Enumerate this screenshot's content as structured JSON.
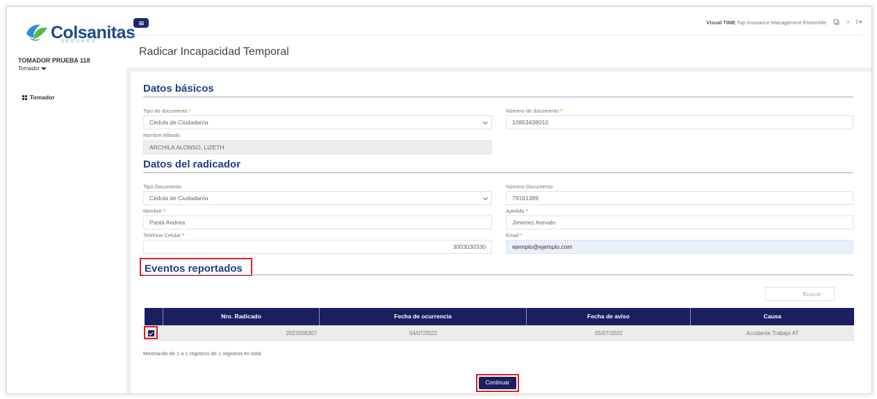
{
  "brand": {
    "name": "Colsanitas",
    "sub": "SEGUROS",
    "colors": {
      "primary": "#1e4a8c",
      "accent": "#4bb7a4",
      "nav_dark": "#1a1f60",
      "highlight": "#e02020"
    }
  },
  "user": {
    "name": "TOMADOR PRUEBA 118",
    "role": "Tomador"
  },
  "sidebar": {
    "items": [
      {
        "label": "Tomador",
        "icon": "grid-icon"
      }
    ]
  },
  "topbar": {
    "app_name": "Visual TIME",
    "app_desc": "Top Insurance Management Ensemble",
    "icons": [
      "notification-icon",
      "help-icon",
      "logout-icon"
    ],
    "help_label": "?"
  },
  "page": {
    "title": "Radicar Incapacidad Temporal"
  },
  "datos_basicos": {
    "title": "Datos básicos",
    "tipo_doc_label": "Tipo de documento",
    "tipo_doc_value": "Cédula de Ciudadanía",
    "num_doc_label": "Número de documento",
    "num_doc_value": "10853438010",
    "nombre_label": "Nombre Afiliado",
    "nombre_value": "ARCHILA ALONSO, LIZETH"
  },
  "datos_radicador": {
    "title": "Datos del radicador",
    "tipo_doc_label": "Tipo Documento",
    "tipo_doc_value": "Cédula de Ciudadanía",
    "num_doc_label": "Número Documento",
    "num_doc_value": "79161389",
    "nombre_label": "Nombre",
    "nombre_value": "Paola Andrea",
    "apellido_label": "Apellido",
    "apellido_value": "Jimenez Arevalo",
    "telefono_label": "Teléfono Celular",
    "telefono_value": "3003030330",
    "email_label": "Email",
    "email_value": "ejemplo@ejemplo.com"
  },
  "eventos": {
    "title": "Eventos reportados",
    "search_placeholder": "Buscar",
    "columns": [
      "Nro. Radicado",
      "Fecha de ocurrencia",
      "Fecha de aviso",
      "Causa"
    ],
    "rows": [
      {
        "checked": true,
        "radicado": "2022008307",
        "fecha_ocurrencia": "04/07/2022",
        "fecha_aviso": "05/07/2022",
        "causa": "Accidente Trabajo AT"
      }
    ],
    "footer": "Mostrando de 1 a 1 registros de 1 registros en total"
  },
  "actions": {
    "continue_label": "Continuar"
  }
}
